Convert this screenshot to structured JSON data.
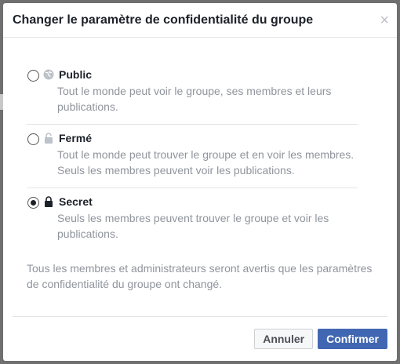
{
  "dialog": {
    "title": "Changer le paramètre de confidentialité du groupe",
    "close_label": "×"
  },
  "options": [
    {
      "title": "Public",
      "description": "Tout le monde peut voir le groupe, ses membres et leurs publications.",
      "icon": "globe-icon",
      "selected": false
    },
    {
      "title": "Fermé",
      "description": "Tout le monde peut trouver le groupe et en voir les membres. Seuls les membres peuvent voir les publications.",
      "icon": "open-lock-icon",
      "selected": false
    },
    {
      "title": "Secret",
      "description": "Seuls les membres peuvent trouver le groupe et voir les publications.",
      "icon": "lock-icon",
      "selected": true
    }
  ],
  "notice": "Tous les membres et administrateurs seront avertis que les paramètres de confidentialité du groupe ont changé.",
  "footer": {
    "cancel_label": "Annuler",
    "confirm_label": "Confirmer"
  },
  "colors": {
    "accent": "#4267b2",
    "muted_text": "#90949c"
  }
}
